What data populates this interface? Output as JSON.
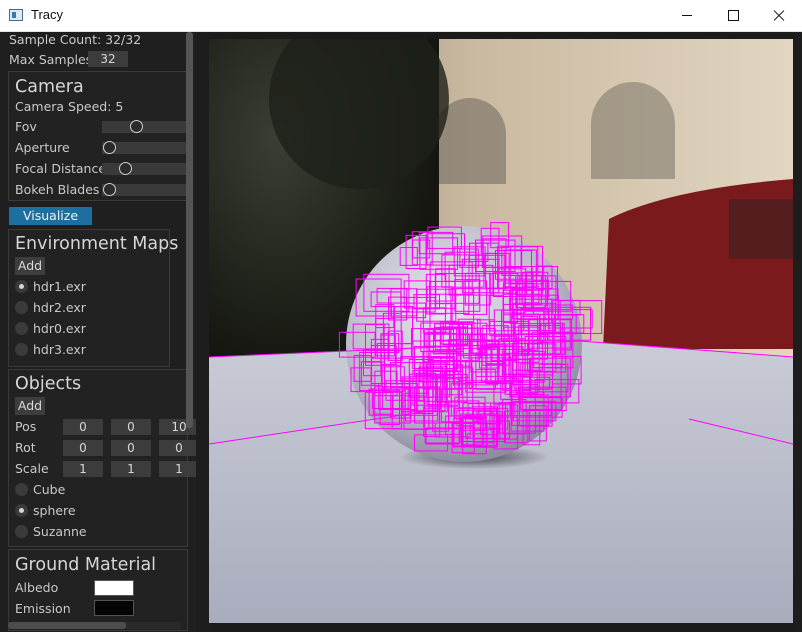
{
  "window": {
    "title": "Tracy"
  },
  "render": {
    "sample_count_text": "Sample Count: 32/32",
    "max_samples_label": "Max Samples",
    "max_samples_value": "32"
  },
  "camera": {
    "header": "Camera",
    "speed_text": "Camera Speed: 5",
    "sliders": [
      {
        "label": "Fov",
        "value": 0.25
      },
      {
        "label": "Aperture",
        "value": 0.0
      },
      {
        "label": "Focal Distance",
        "value": 0.2
      },
      {
        "label": "Bokeh Blades",
        "value": 0.0
      }
    ]
  },
  "visualize_bvh_button": "Visualize BVH",
  "environment_maps": {
    "header": "Environment Maps",
    "add_label": "Add",
    "items": [
      {
        "label": "hdr1.exr",
        "selected": true
      },
      {
        "label": "hdr2.exr",
        "selected": false
      },
      {
        "label": "hdr0.exr",
        "selected": false
      },
      {
        "label": "hdr3.exr",
        "selected": false
      }
    ]
  },
  "objects": {
    "header": "Objects",
    "add_label": "Add",
    "pos_label": "Pos",
    "pos_values": [
      "0",
      "0",
      "10"
    ],
    "rot_label": "Rot",
    "rot_values": [
      "0",
      "0",
      "0"
    ],
    "scale_label": "Scale",
    "scale_values": [
      "1",
      "1",
      "1"
    ],
    "items": [
      {
        "label": "Cube",
        "selected": false
      },
      {
        "label": "sphere",
        "selected": true
      },
      {
        "label": "Suzanne",
        "selected": false
      }
    ]
  },
  "ground_material": {
    "header": "Ground Material",
    "albedo_label": "Albedo",
    "albedo_color": "#ffffff",
    "emission_label": "Emission",
    "emission_color": "#050505"
  },
  "colors": {
    "bvh_wireframe": "#ff00ff",
    "accent_button": "#1d6fa0"
  }
}
